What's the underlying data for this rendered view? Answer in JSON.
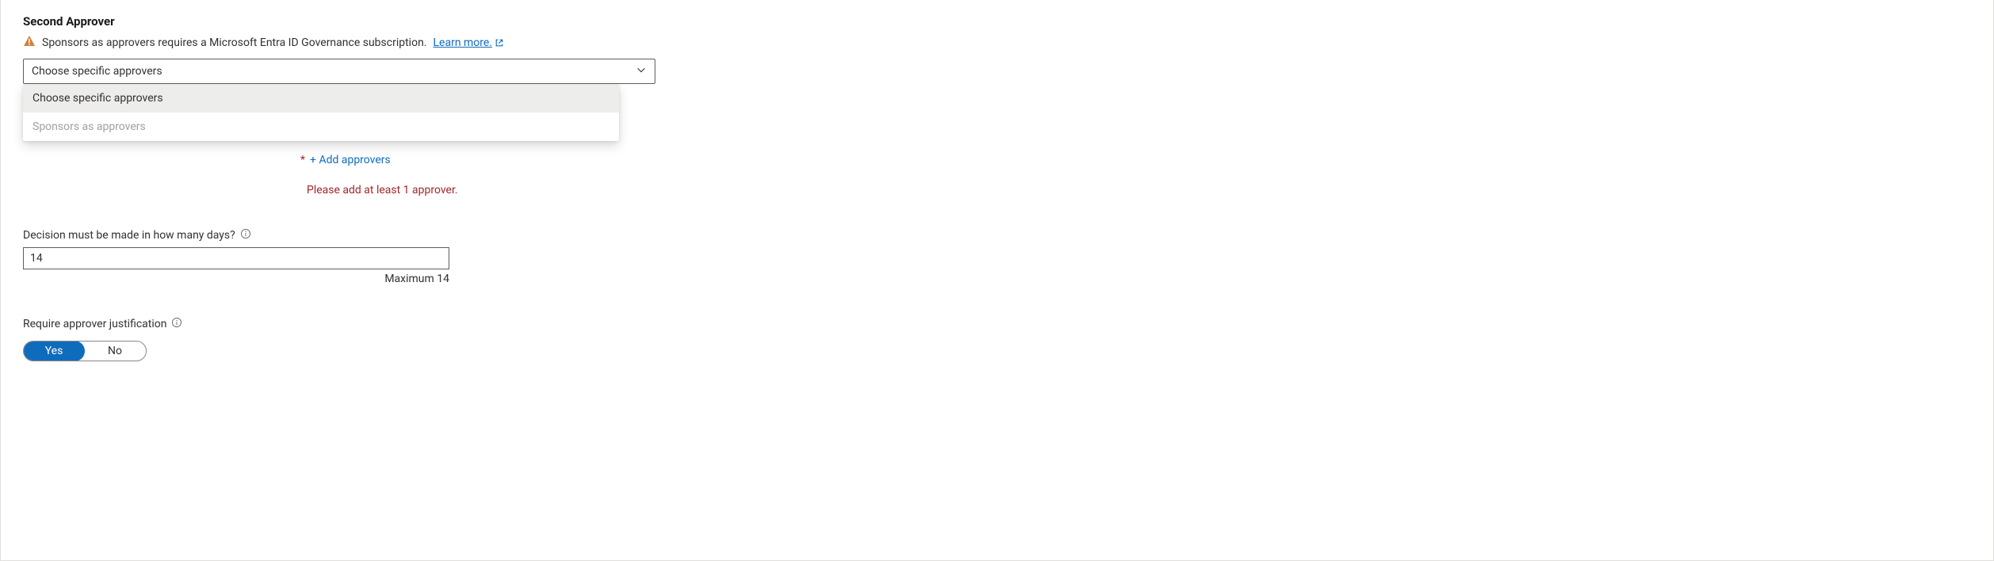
{
  "section": {
    "title": "Second Approver"
  },
  "warning": {
    "text": "Sponsors as approvers requires a Microsoft Entra ID Governance subscription.",
    "link_text": "Learn more."
  },
  "approver_select": {
    "selected": "Choose specific approvers",
    "options": {
      "0": {
        "label": "Choose specific approvers"
      },
      "1": {
        "label": "Sponsors as approvers"
      }
    }
  },
  "add_approvers": {
    "label": "+ Add approvers",
    "error": "Please add at least 1 approver."
  },
  "decision_days": {
    "label": "Decision must be made in how many days?",
    "value": "14",
    "hint": "Maximum 14"
  },
  "justification": {
    "label": "Require approver justification",
    "yes": "Yes",
    "no": "No"
  }
}
